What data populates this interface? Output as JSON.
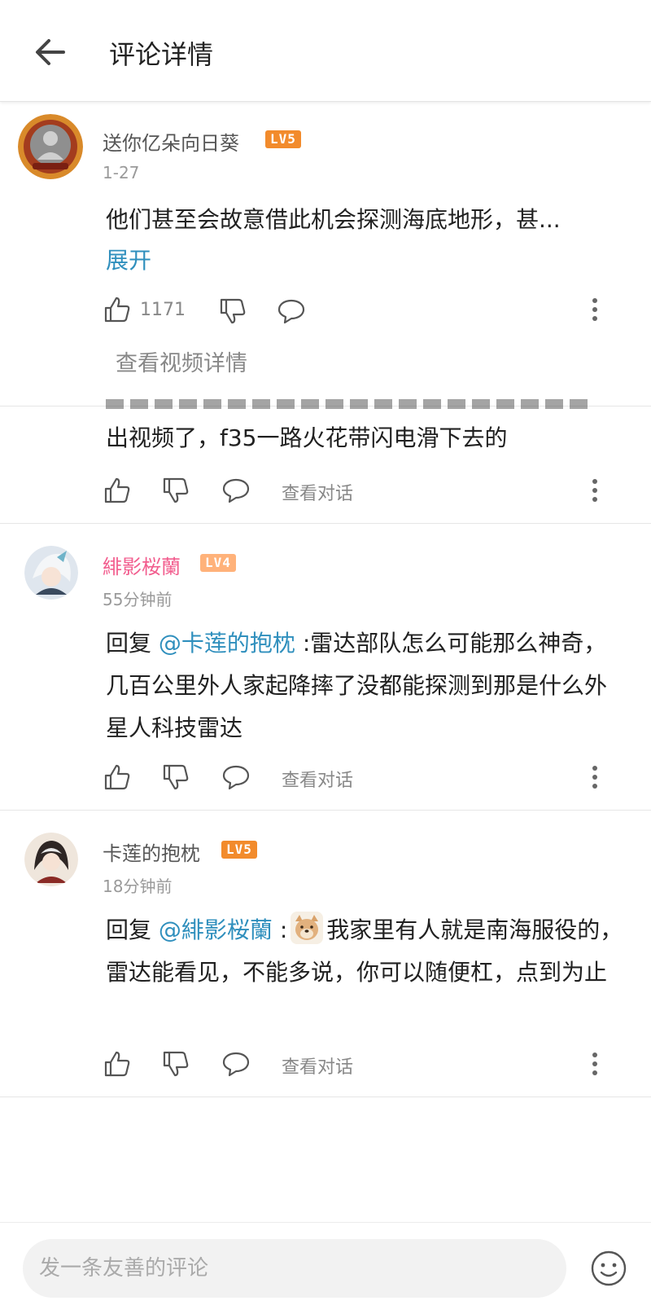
{
  "header": {
    "title": "评论详情"
  },
  "root_comment": {
    "username": "送你亿朵向日葵",
    "level": "LV5",
    "level_color": "#f28b2c",
    "time": "1-27",
    "text": "他们甚至会故意借此机会探测海底地形，甚...",
    "expand_label": "展开",
    "likes": "1171",
    "view_video_label": "查看视频详情"
  },
  "replies": [
    {
      "text": "出视频了，f35一路火花带闪电滑下去的",
      "view_dialog_label": "查看对话"
    },
    {
      "username": "緋影桜蘭",
      "username_color": "#f25d8e",
      "level": "LV4",
      "level_color": "#ffb27a",
      "time": "55分钟前",
      "reply_prefix": "回复 ",
      "mention": "@卡莲的抱枕",
      "text": " :雷达部队怎么可能那么神奇，几百公里外人家起降摔了没都能探测到那是什么外星人科技雷达",
      "view_dialog_label": "查看对话"
    },
    {
      "username": "卡莲的抱枕",
      "level": "LV5",
      "level_color": "#f28b2c",
      "time": "18分钟前",
      "reply_prefix": "回复 ",
      "mention": "@緋影桜蘭",
      "mention_suffix": " :",
      "text": "我家里有人就是南海服役的，雷达能看见，不能多说，你可以随便杠，点到为止",
      "view_dialog_label": "查看对话"
    }
  ],
  "footer": {
    "placeholder": "发一条友善的评论"
  },
  "colors": {
    "accent_blue": "#2f8fbd",
    "pink": "#f25d8e"
  }
}
